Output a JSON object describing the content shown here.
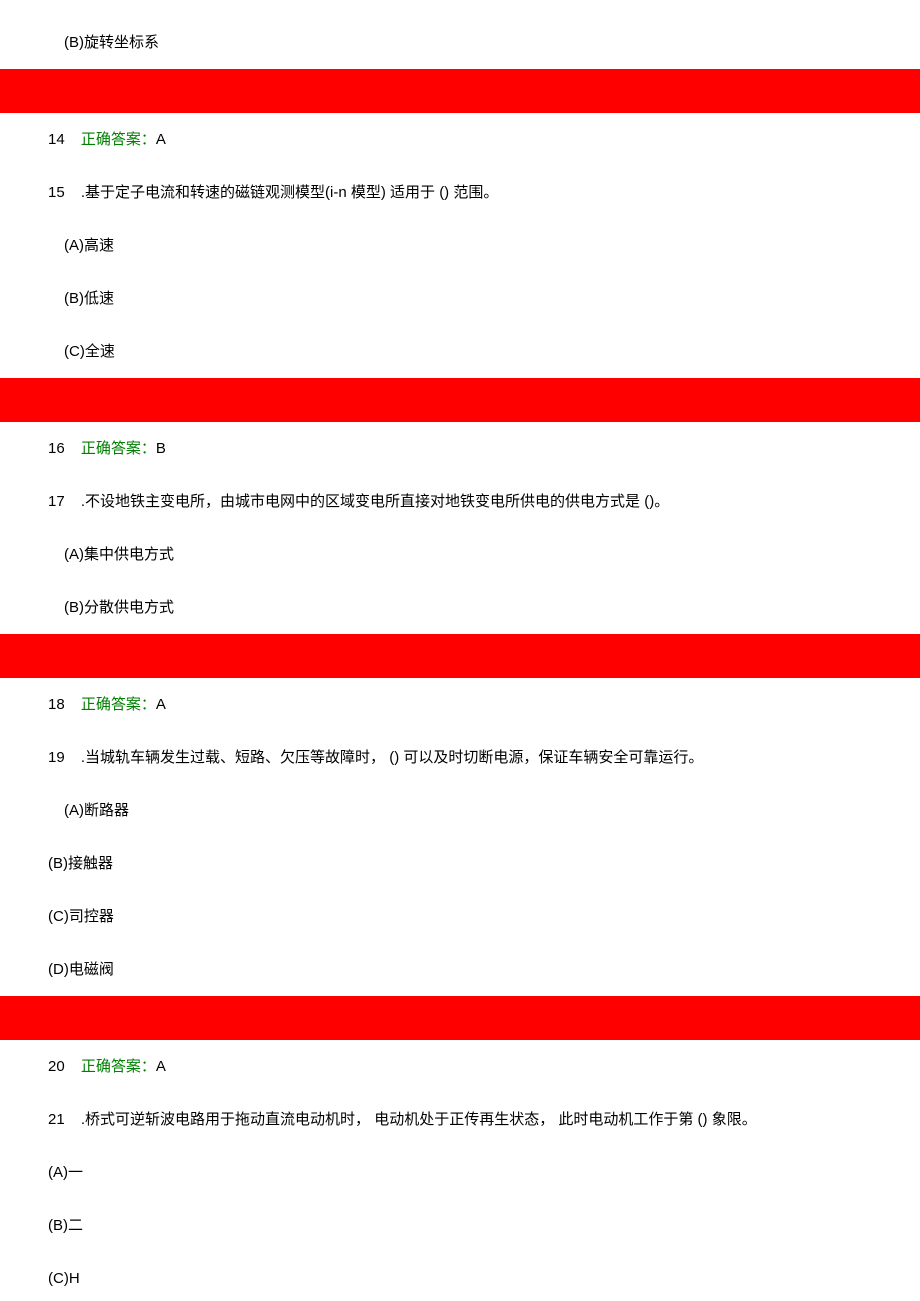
{
  "q14": {
    "optionB": "(B)旋转坐标系",
    "answerNum": "14",
    "answerLabel": "正确答案：",
    "answerValue": "A"
  },
  "q15": {
    "num": "15",
    "text": ".基于定子电流和转速的磁链观测模型(i-n 模型) 适用于 () 范围。",
    "optionA": "(A)高速",
    "optionB": "(B)低速",
    "optionC": "(C)全速",
    "answerNum": "16",
    "answerLabel": "正确答案：",
    "answerValue": "B"
  },
  "q17": {
    "num": "17",
    "text": ".不设地铁主变电所，由城市电网中的区域变电所直接对地铁变电所供电的供电方式是 ()。",
    "optionA": "(A)集中供电方式",
    "optionB": "(B)分散供电方式",
    "answerNum": "18",
    "answerLabel": "正确答案：",
    "answerValue": "A"
  },
  "q19": {
    "num": "19",
    "text": ".当城轨车辆发生过载、短路、欠压等故障时， () 可以及时切断电源，保证车辆安全可靠运行。",
    "optionA": "(A)断路器",
    "optionB": "(B)接触器",
    "optionC": "(C)司控器",
    "optionD": "(D)电磁阀",
    "answerNum": "20",
    "answerLabel": "正确答案：",
    "answerValue": "A"
  },
  "q21": {
    "num": "21",
    "text": ".桥式可逆斩波电路用于拖动直流电动机时， 电动机处于正传再生状态， 此时电动机工作于第 () 象限。",
    "optionA": "(A)一",
    "optionB": "(B)二",
    "optionC": "(C)H"
  }
}
